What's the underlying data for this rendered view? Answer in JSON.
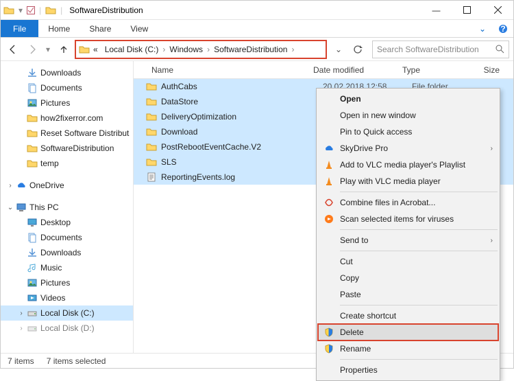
{
  "window": {
    "title": "SoftwareDistribution"
  },
  "ribbon": {
    "file": "File",
    "home": "Home",
    "share": "Share",
    "view": "View"
  },
  "breadcrumb": {
    "prefix": "«",
    "parts": [
      "Local Disk (C:)",
      "Windows",
      "SoftwareDistribution"
    ]
  },
  "search": {
    "placeholder": "Search SoftwareDistribution"
  },
  "columns": {
    "name": "Name",
    "date": "Date modified",
    "type": "Type",
    "size": "Size"
  },
  "tree": {
    "downloads": "Downloads",
    "documents": "Documents",
    "pictures": "Pictures",
    "how2fixerror": "how2fixerror.com",
    "reset": "Reset Software Distribut",
    "softdist": "SoftwareDistribution",
    "temp": "temp",
    "onedrive": "OneDrive",
    "thispc": "This PC",
    "desktop": "Desktop",
    "documents2": "Documents",
    "downloads2": "Downloads",
    "music": "Music",
    "pictures2": "Pictures",
    "videos": "Videos",
    "c": "Local Disk (C:)",
    "d": "Local Disk (D:)"
  },
  "files": [
    {
      "name": "AuthCabs",
      "icon": "folder",
      "date": "20 02 2018 12:58",
      "type": "File folder"
    },
    {
      "name": "DataStore",
      "icon": "folder",
      "date": "",
      "type": ""
    },
    {
      "name": "DeliveryOptimization",
      "icon": "folder",
      "date": "",
      "type": ""
    },
    {
      "name": "Download",
      "icon": "folder",
      "date": "",
      "type": ""
    },
    {
      "name": "PostRebootEventCache.V2",
      "icon": "folder",
      "date": "",
      "type": ""
    },
    {
      "name": "SLS",
      "icon": "folder",
      "date": "",
      "type": ""
    },
    {
      "name": "ReportingEvents.log",
      "icon": "file",
      "date": "",
      "type": ""
    }
  ],
  "ctx": {
    "open": "Open",
    "open_new": "Open in new window",
    "pin": "Pin to Quick access",
    "skydrive": "SkyDrive Pro",
    "vlc_add": "Add to VLC media player's Playlist",
    "vlc_play": "Play with VLC media player",
    "acrobat": "Combine files in Acrobat...",
    "avast": "Scan selected items for viruses",
    "sendto": "Send to",
    "cut": "Cut",
    "copy": "Copy",
    "paste": "Paste",
    "shortcut": "Create shortcut",
    "delete": "Delete",
    "rename": "Rename",
    "properties": "Properties"
  },
  "status": {
    "count": "7 items",
    "selected": "7 items selected"
  }
}
